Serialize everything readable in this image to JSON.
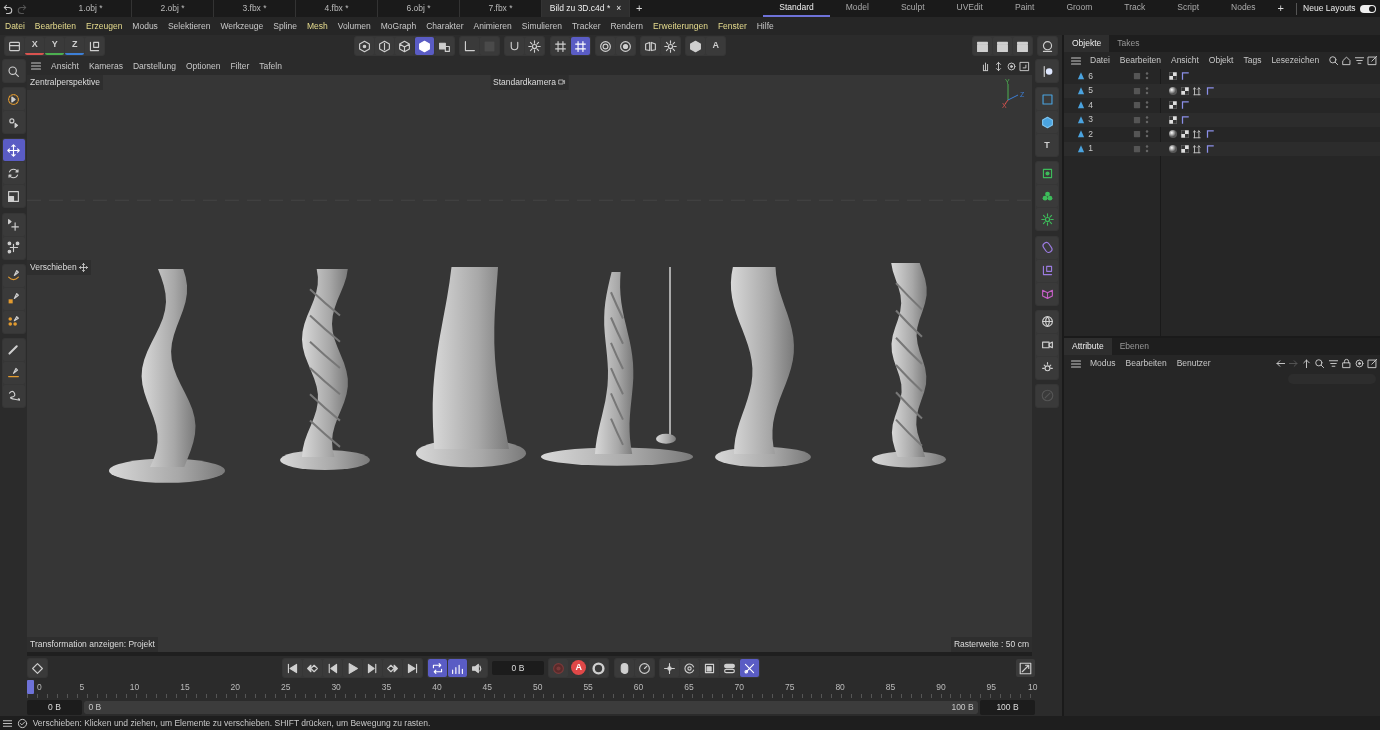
{
  "doc_tabs": [
    {
      "label": "1.obj *",
      "selected": false
    },
    {
      "label": "2.obj *",
      "selected": false
    },
    {
      "label": "3.fbx *",
      "selected": false
    },
    {
      "label": "4.fbx *",
      "selected": false
    },
    {
      "label": "6.obj *",
      "selected": false
    },
    {
      "label": "7.fbx *",
      "selected": false
    },
    {
      "label": "Bild zu 3D.c4d *",
      "selected": true,
      "close": "×"
    }
  ],
  "new_doc": "+",
  "layouts": [
    {
      "label": "Standard",
      "selected": true
    },
    {
      "label": "Model",
      "selected": false
    },
    {
      "label": "Sculpt",
      "selected": false
    },
    {
      "label": "UVEdit",
      "selected": false
    },
    {
      "label": "Paint",
      "selected": false
    },
    {
      "label": "Groom",
      "selected": false
    },
    {
      "label": "Track",
      "selected": false
    },
    {
      "label": "Script",
      "selected": false
    },
    {
      "label": "Nodes",
      "selected": false
    }
  ],
  "add_layout": "+",
  "layout_switch": {
    "label": "Neue Layouts",
    "on": true
  },
  "menu": [
    {
      "label": "Datei",
      "highlight": true
    },
    {
      "label": "Bearbeiten",
      "highlight": true
    },
    {
      "label": "Erzeugen",
      "highlight": true
    },
    {
      "label": "Modus",
      "highlight": false
    },
    {
      "label": "Selektieren",
      "highlight": false
    },
    {
      "label": "Werkzeuge",
      "highlight": false
    },
    {
      "label": "Spline",
      "highlight": false
    },
    {
      "label": "Mesh",
      "highlight": true
    },
    {
      "label": "Volumen",
      "highlight": false
    },
    {
      "label": "MoGraph",
      "highlight": false
    },
    {
      "label": "Charakter",
      "highlight": false
    },
    {
      "label": "Animieren",
      "highlight": false
    },
    {
      "label": "Simulieren",
      "highlight": false
    },
    {
      "label": "Tracker",
      "highlight": false
    },
    {
      "label": "Rendern",
      "highlight": false
    },
    {
      "label": "Erweiterungen",
      "highlight": true
    },
    {
      "label": "Fenster",
      "highlight": true
    },
    {
      "label": "Hilfe",
      "highlight": false
    }
  ],
  "toolbar": {
    "left": [
      [
        {
          "selected": false
        },
        {
          "label": "X",
          "color": "#d9534f"
        },
        {
          "label": "Y",
          "color": "#4caf50"
        },
        {
          "label": "Z",
          "color": "#3d7fd6"
        },
        {
          "selected": false
        }
      ],
      [
        {
          "selected": false
        },
        {
          "selected": false
        },
        {
          "selected": false
        },
        {
          "selected": true
        },
        {
          "selected": false
        }
      ],
      [
        {
          "selected": false
        },
        {
          "selected": false
        }
      ],
      [
        {
          "selected": false
        },
        {
          "selected": false
        }
      ],
      [
        {
          "selected": false
        },
        {
          "selected": true
        }
      ],
      [
        {
          "selected": false
        },
        {
          "selected": false
        }
      ],
      [
        {
          "selected": false
        },
        {
          "selected": false
        }
      ],
      [
        {
          "selected": false
        },
        {
          "label": "A"
        }
      ]
    ],
    "right": [
      [
        {
          "selected": false
        },
        {
          "selected": false
        },
        {
          "selected": false
        }
      ],
      [
        {
          "selected": false
        }
      ]
    ]
  },
  "left_tools": [
    [
      {
        "selected": false
      }
    ],
    [
      {
        "selected": false
      },
      {
        "selected": false
      }
    ],
    [
      {
        "selected": true
      },
      {
        "selected": false
      },
      {
        "selected": false
      }
    ],
    [
      {
        "selected": false
      },
      {
        "selected": false
      }
    ],
    [
      {
        "selected": false
      },
      {
        "selected": false
      },
      {
        "selected": false
      }
    ],
    [
      {
        "selected": false
      },
      {
        "selected": false
      },
      {
        "selected": false
      }
    ]
  ],
  "right_tools": [
    [
      {
        "selected": false
      }
    ],
    [
      {
        "selected": false
      },
      {
        "selected": false
      },
      {
        "label": "T"
      }
    ],
    [
      {
        "selected": false
      },
      {
        "selected": false
      },
      {
        "selected": false
      }
    ],
    [
      {
        "selected": false
      },
      {
        "selected": false
      },
      {
        "selected": false
      }
    ],
    [
      {
        "selected": false
      },
      {
        "selected": false
      },
      {
        "selected": false
      }
    ],
    [
      {
        "selected": false
      }
    ]
  ],
  "view_menu": [
    "Ansicht",
    "Kameras",
    "Darstellung",
    "Optionen",
    "Filter",
    "Tafeln"
  ],
  "viewport": {
    "projection": "Zentralperspektive",
    "camera": "Standardkamera",
    "tool_hint": "Verschieben",
    "transform_info": "Transformation anzeigen: Projekt",
    "grid_size": "Rasterweite : 50 cm",
    "gizmo": [
      "Y",
      "Z",
      "X"
    ]
  },
  "timeline": {
    "groups": [
      [
        {
          "selected": false
        }
      ],
      [
        {
          "selected": false
        },
        {
          "selected": false
        },
        {
          "selected": false
        },
        {
          "selected": false
        },
        {
          "selected": false
        },
        {
          "selected": false
        },
        {
          "selected": false
        }
      ],
      [
        {
          "selected": true
        },
        {
          "selected": true
        },
        {
          "selected": false
        }
      ]
    ],
    "frame": "0 B",
    "groups2": [
      [
        {
          "selected": false
        },
        {
          "label": "A"
        },
        {
          "selected": false
        }
      ],
      [
        {
          "selected": false
        },
        {
          "selected": false
        }
      ],
      [
        {
          "selected": false
        },
        {
          "selected": false
        },
        {
          "selected": false
        },
        {
          "selected": false
        },
        {
          "selected": true
        }
      ]
    ],
    "end_button": {
      "selected": false
    },
    "ruler": {
      "labels": [
        "0",
        "5",
        "10",
        "15",
        "20",
        "25",
        "30",
        "35",
        "40",
        "45",
        "50",
        "55",
        "60",
        "65",
        "70",
        "75",
        "80",
        "85",
        "90",
        "95",
        "10"
      ],
      "level": 0
    },
    "range": {
      "start": "0 B",
      "slider_start": "0 B",
      "slider_end": "100 B",
      "end": "100 B",
      "level": 1
    }
  },
  "objects_panel": {
    "tabs": [
      {
        "label": "Objekte",
        "selected": true
      },
      {
        "label": "Takes",
        "selected": false
      }
    ],
    "menu": [
      "Datei",
      "Bearbeiten",
      "Ansicht",
      "Objekt",
      "Tags",
      "Lesezeichen"
    ],
    "rows": [
      {
        "name": "6",
        "tags": [
          {
            "kind": "checker"
          },
          {
            "kind": "flag"
          }
        ]
      },
      {
        "name": "5",
        "tags": [
          {
            "kind": "material"
          },
          {
            "kind": "checker"
          },
          {
            "kind": "ik"
          },
          {
            "kind": "flag"
          }
        ]
      },
      {
        "name": "4",
        "tags": [
          {
            "kind": "checker"
          },
          {
            "kind": "flag"
          }
        ]
      },
      {
        "name": "3",
        "tags": [
          {
            "kind": "checker"
          },
          {
            "kind": "flag"
          }
        ]
      },
      {
        "name": "2",
        "tags": [
          {
            "kind": "material"
          },
          {
            "kind": "checker"
          },
          {
            "kind": "ik"
          },
          {
            "kind": "flag"
          }
        ]
      },
      {
        "name": "1",
        "tags": [
          {
            "kind": "material"
          },
          {
            "kind": "checker"
          },
          {
            "kind": "ik"
          },
          {
            "kind": "flag"
          }
        ]
      }
    ]
  },
  "attributes_panel": {
    "tabs": [
      {
        "label": "Attribute",
        "selected": true
      },
      {
        "label": "Ebenen",
        "selected": false
      }
    ],
    "menu": [
      "Modus",
      "Bearbeiten",
      "Benutzer"
    ]
  },
  "status": "Verschieben: Klicken und ziehen, um Elemente zu verschieben. SHIFT drücken, um Bewegung zu rasten."
}
